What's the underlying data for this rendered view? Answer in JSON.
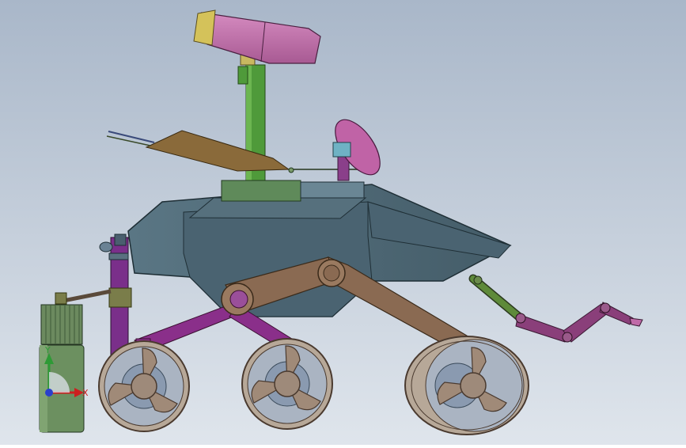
{
  "viewport": {
    "background_top": "#a9b7c9",
    "background_bottom": "#dfe5ec"
  },
  "triad": {
    "x_label": "X",
    "y_label": "Y"
  },
  "colors": {
    "body": "#4d6773",
    "body_dark": "#3e5560",
    "bogie_brown": "#8a6a52",
    "bogie_dark": "#6e5240",
    "purple_link": "#8a2f8a",
    "mast_green": "#4f9a3a",
    "camera_pink": "#c072a8",
    "camera_yellow": "#c9b860",
    "olive": "#7a7d4a",
    "arm_green": "#5e8a3a",
    "arm_purple": "#8a3f7a",
    "wheel_tan": "#9e8a7a",
    "hub_blue": "#7a8aa0",
    "cyan_part": "#6fb2c4"
  }
}
